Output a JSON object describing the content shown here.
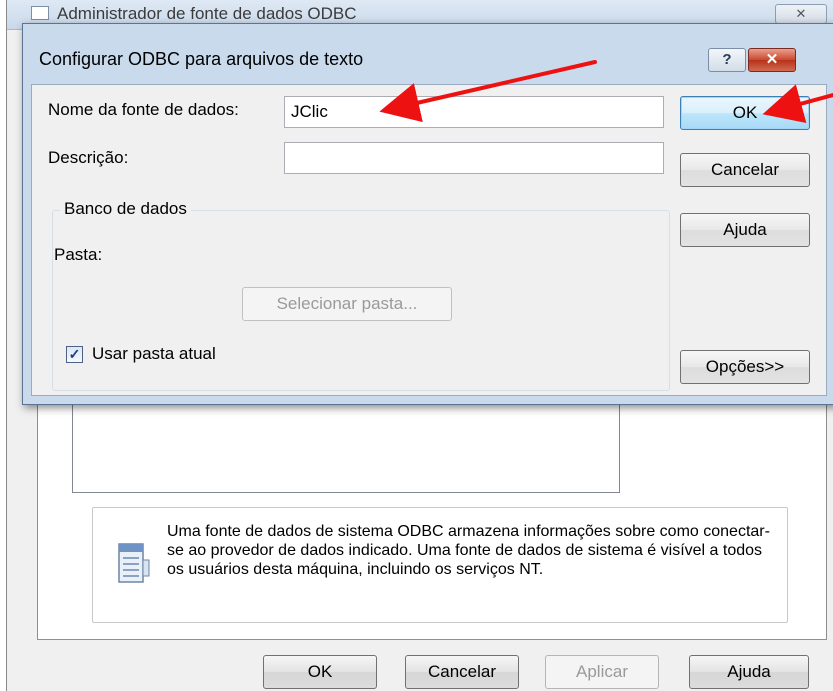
{
  "back_window": {
    "title": "Administrador de fonte de dados ODBC",
    "close_glyph": "✕",
    "info_text": "Uma fonte de dados de sistema ODBC armazena informações sobre como conectar-se ao provedor de dados indicado. Uma fonte de dados de sistema é visível a todos os usuários desta máquina, incluindo os serviços NT.",
    "buttons": {
      "ok": "OK",
      "cancel": "Cancelar",
      "apply": "Aplicar",
      "help": "Ajuda"
    },
    "info_icon": "database-document-icon"
  },
  "dialog": {
    "title": "Configurar ODBC para arquivos de texto",
    "help_glyph": "?",
    "close_glyph": "✕",
    "data_source_name_label": "Nome da fonte de dados:",
    "data_source_name_value": "JClic",
    "description_label": "Descrição:",
    "description_value": "",
    "group_title": "Banco de dados",
    "folder_label": "Pasta:",
    "select_folder_button": "Selecionar pasta...",
    "use_current_folder_label": "Usar pasta atual",
    "use_current_folder_checked": true,
    "check_glyph": "✓",
    "buttons": {
      "ok": "OK",
      "cancel": "Cancelar",
      "help": "Ajuda",
      "options": "Opções>>"
    }
  },
  "annotation": {
    "arrow_color": "#ee1111"
  }
}
